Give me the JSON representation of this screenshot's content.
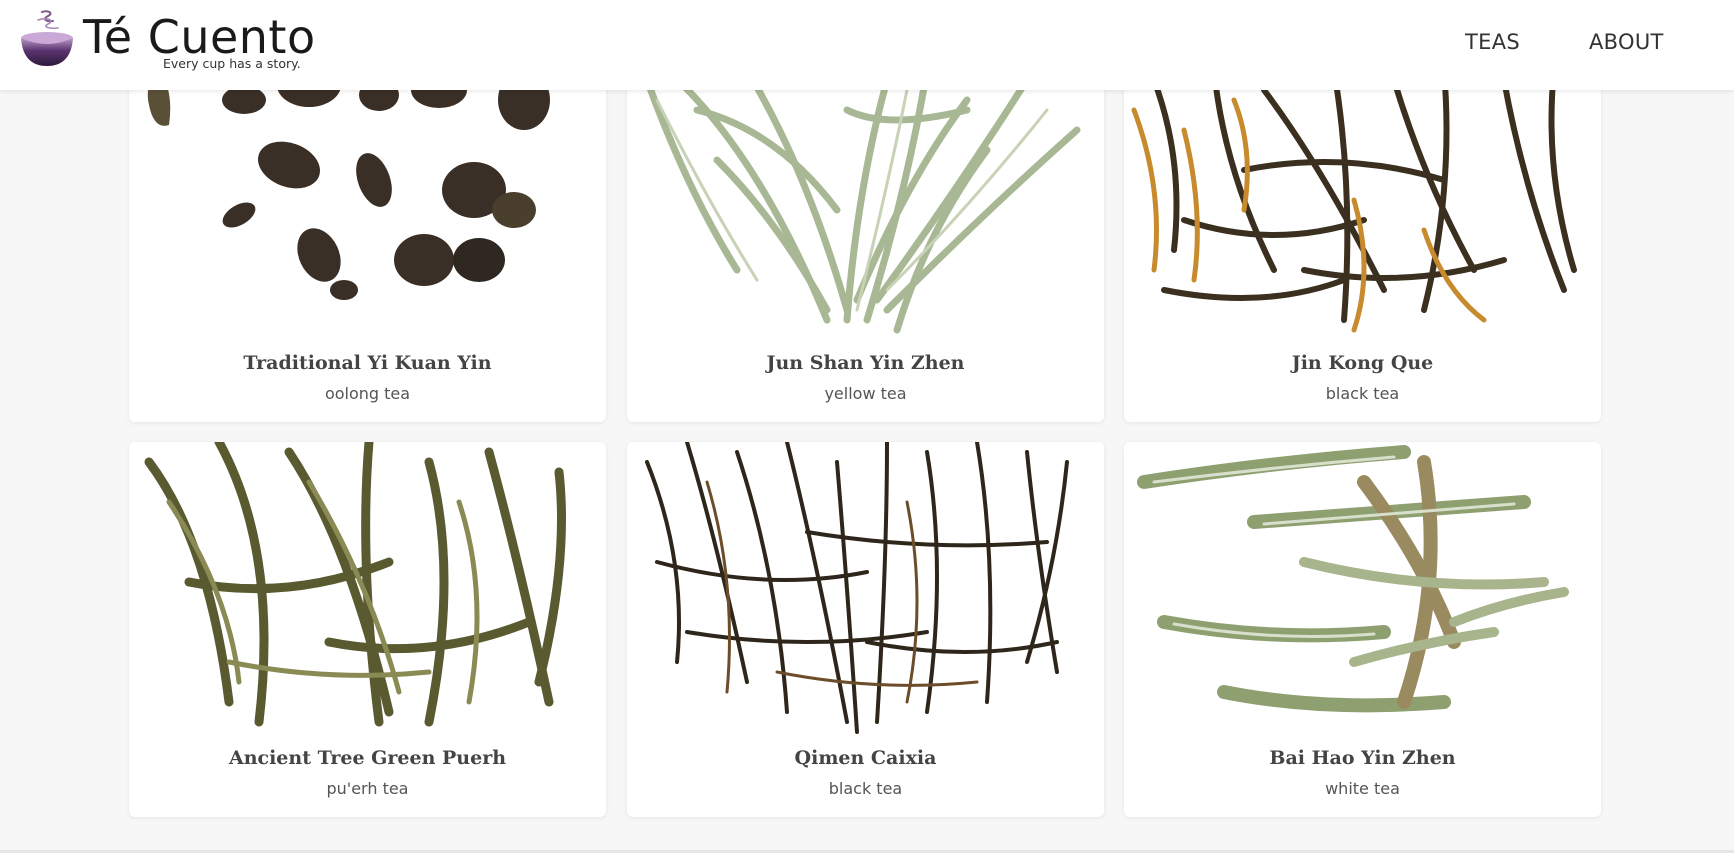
{
  "brand": {
    "title": "Té Cuento",
    "tagline": "Every cup has a story."
  },
  "nav": {
    "teas": "TEAS",
    "about": "ABOUT"
  },
  "teas": [
    {
      "name": "Traditional Yi Kuan Yin",
      "type": "oolong tea"
    },
    {
      "name": "Jun Shan Yin Zhen",
      "type": "yellow tea"
    },
    {
      "name": "Jin Kong Que",
      "type": "black tea"
    },
    {
      "name": "Ancient Tree Green Puerh",
      "type": "pu'erh tea"
    },
    {
      "name": "Qimen Caixia",
      "type": "black tea"
    },
    {
      "name": "Bai Hao Yin Zhen",
      "type": "white tea"
    }
  ],
  "colors": {
    "brand_purple": "#4e2a5e",
    "oolong": "#3a2f26",
    "yellow_tea": "#a9b894",
    "black_tea": "#3b3020",
    "black_tea_gold": "#c78a2c",
    "puerh": "#6b6b3a",
    "white_tea": "#8fa070"
  }
}
